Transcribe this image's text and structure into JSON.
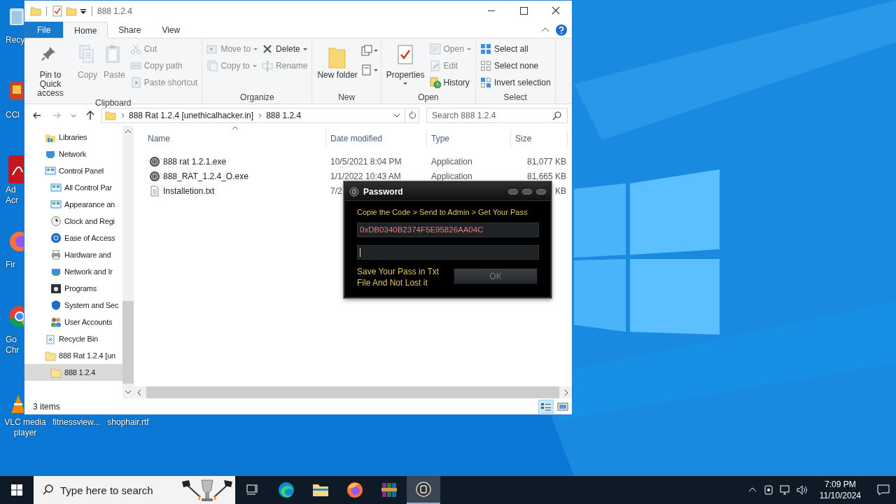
{
  "desktop": {
    "left_icons": [
      {
        "label": "Recy",
        "kind": "bin"
      },
      {
        "label": "CCl",
        "kind": "cleaner"
      },
      {
        "label": "Ad Acr",
        "kind": "pdf"
      },
      {
        "label": "Fir",
        "kind": "firefox"
      },
      {
        "label": "Go Chr",
        "kind": "chrome"
      }
    ],
    "bottom_icons": [
      {
        "label": "VLC media player",
        "kind": "vlc"
      },
      {
        "label": "fitnessview...",
        "kind": "hidden"
      },
      {
        "label": "shophair.rtf",
        "kind": "hidden"
      }
    ]
  },
  "window": {
    "title": "888 1.2.4",
    "ribbon_tabs": [
      {
        "label": "File",
        "kind": "file",
        "selected": false
      },
      {
        "label": "Home",
        "kind": "tab",
        "selected": true
      },
      {
        "label": "Share",
        "kind": "tab",
        "selected": false
      },
      {
        "label": "View",
        "kind": "tab",
        "selected": false
      }
    ],
    "ribbon_groups": [
      {
        "label": "Clipboard",
        "columns": [
          [
            {
              "label": "Pin to Quick access",
              "kind": "large",
              "disabled": false
            }
          ],
          [
            {
              "label": "Copy",
              "kind": "large",
              "disabled": true
            }
          ],
          [
            {
              "label": "Paste",
              "kind": "large",
              "disabled": true
            }
          ],
          [
            {
              "label": "Cut",
              "kind": "small",
              "disabled": true
            },
            {
              "label": "Copy path",
              "kind": "small",
              "disabled": true
            },
            {
              "label": "Paste shortcut",
              "kind": "small",
              "disabled": true
            }
          ]
        ]
      },
      {
        "label": "Organize",
        "columns": [
          [
            {
              "label": "Move to",
              "kind": "small",
              "disabled": true,
              "dropdown": true
            },
            {
              "label": "Copy to",
              "kind": "small",
              "disabled": true,
              "dropdown": true
            }
          ],
          [
            {
              "label": "Delete",
              "kind": "small",
              "disabled": false,
              "dropdown": true
            },
            {
              "label": "Rename",
              "kind": "small",
              "disabled": true
            }
          ]
        ]
      },
      {
        "label": "New",
        "columns": [
          [
            {
              "label": "New folder",
              "kind": "large",
              "disabled": false
            }
          ],
          [
            {
              "kind": "icon",
              "disabled": false,
              "dropdown": true
            },
            {
              "kind": "icon",
              "disabled": false,
              "dropdown": true
            }
          ]
        ]
      },
      {
        "label": "Open",
        "columns": [
          [
            {
              "label": "Properties",
              "kind": "large",
              "disabled": false,
              "dropdown": true
            }
          ],
          [
            {
              "label": "Open",
              "kind": "small",
              "disabled": true,
              "dropdown": true
            },
            {
              "label": "Edit",
              "kind": "small",
              "disabled": true
            },
            {
              "label": "History",
              "kind": "small",
              "disabled": false
            }
          ]
        ]
      },
      {
        "label": "Select",
        "columns": [
          [
            {
              "label": "Select all",
              "kind": "small",
              "disabled": false
            },
            {
              "label": "Select none",
              "kind": "small",
              "disabled": false
            },
            {
              "label": "Invert selection",
              "kind": "small",
              "disabled": false
            }
          ]
        ]
      }
    ],
    "address": {
      "crumbs": [
        "888 Rat 1.2.4 [unethicalhacker.in]",
        "888 1.2.4"
      ],
      "search_placeholder": "Search 888 1.2.4"
    },
    "nav_tree": [
      {
        "label": "Libraries",
        "kind": "library",
        "selected": false
      },
      {
        "label": "Network",
        "kind": "network",
        "selected": false
      },
      {
        "label": "Control Panel",
        "kind": "panel",
        "selected": false,
        "children": [
          {
            "label": "All Control Par",
            "kind": "panel",
            "selected": false
          },
          {
            "label": "Appearance an",
            "kind": "panel",
            "selected": false
          },
          {
            "label": "Clock and Regi",
            "kind": "clock",
            "selected": false
          },
          {
            "label": "Ease of Access",
            "kind": "access",
            "selected": false
          },
          {
            "label": "Hardware and",
            "kind": "printer",
            "selected": false
          },
          {
            "label": "Network and Ir",
            "kind": "network",
            "selected": false
          },
          {
            "label": "Programs",
            "kind": "disc",
            "selected": false
          },
          {
            "label": "System and Sec",
            "kind": "shield",
            "selected": false
          },
          {
            "label": "User Accounts",
            "kind": "users",
            "selected": false
          }
        ]
      },
      {
        "label": "Recycle Bin",
        "kind": "bin",
        "selected": false
      },
      {
        "label": "888 Rat 1.2.4 [un",
        "kind": "folder",
        "selected": false,
        "children": [
          {
            "label": "888 1.2.4",
            "kind": "folder",
            "selected": true
          }
        ]
      }
    ],
    "columns": [
      "Name",
      "Date modified",
      "Type",
      "Size"
    ],
    "files": [
      {
        "name": "888 rat 1.2.1.exe",
        "kind": "exe",
        "date": "10/5/2021 8:04 PM",
        "type": "Application",
        "size": "81,077 KB"
      },
      {
        "name": "888_RAT_1.2.4_O.exe",
        "kind": "exe",
        "date": "1/1/2022 10:43 AM",
        "type": "Application",
        "size": "81,665 KB"
      },
      {
        "name": "Installetion.txt",
        "kind": "txt",
        "date": "7/2",
        "size": "KB"
      }
    ],
    "status": "3 items",
    "views": [
      {
        "kind": "details",
        "selected": true
      },
      {
        "kind": "tiles",
        "selected": false
      }
    ]
  },
  "dialog": {
    "title": "Password",
    "instruction": "Copie the Code > Send to Admin > Get Your Pass",
    "code": "0xDB0340B2374F5E95826AA04C",
    "note": "Save Your Pass in Txt File And Not Lost it",
    "button": "OK"
  },
  "taskbar": {
    "search_placeholder": "Type here to search",
    "apps": [
      {
        "kind": "edge",
        "selected": false
      },
      {
        "kind": "explorer",
        "selected": false
      },
      {
        "kind": "firefox",
        "selected": false
      },
      {
        "kind": "archive",
        "selected": false
      },
      {
        "kind": "app",
        "selected": true
      }
    ],
    "time": "7:09 PM",
    "date": "11/10/2024"
  }
}
